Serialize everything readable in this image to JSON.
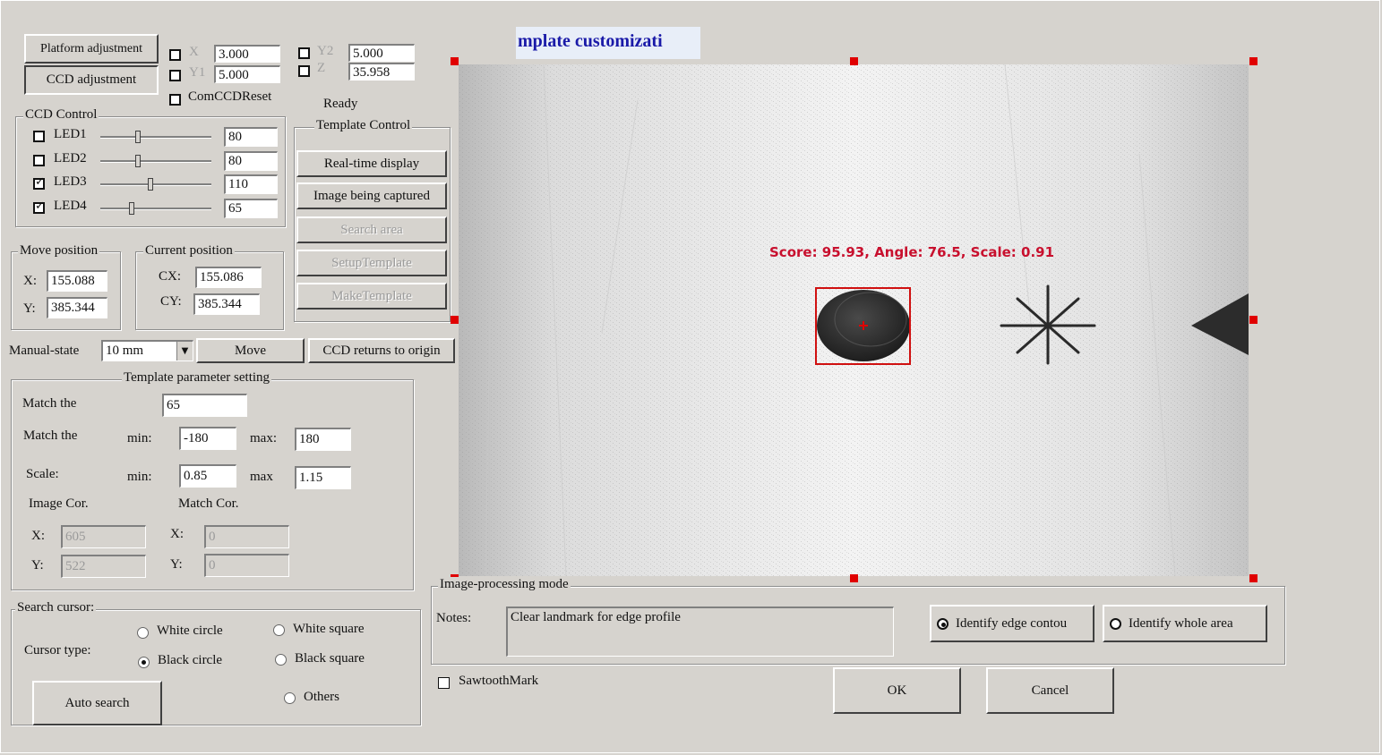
{
  "tabs": {
    "platform_adjustment": "Platform adjustment",
    "ccd_adjustment": "CCD adjustment"
  },
  "coords": {
    "x_label": "X",
    "x_value": "3.000",
    "y1_label": "Y1",
    "y1_value": "5.000",
    "y2_label": "Y2",
    "y2_value": "5.000",
    "z_label": "Z",
    "z_value": "35.958",
    "com_ccd_reset": "ComCCDReset",
    "status": "Ready"
  },
  "ccd_control": {
    "title": "CCD Control",
    "leds": [
      {
        "label": "LED1",
        "checked": false,
        "value": "80",
        "level": 80
      },
      {
        "label": "LED2",
        "checked": false,
        "value": "80",
        "level": 80
      },
      {
        "label": "LED3",
        "checked": true,
        "value": "110",
        "level": 110
      },
      {
        "label": "LED4",
        "checked": true,
        "value": "65",
        "level": 65
      }
    ]
  },
  "template_control": {
    "title": "Template Control",
    "realtime": "Real-time display",
    "captured": "Image being captured",
    "search_area": "Search area",
    "setup_template": "SetupTemplate",
    "make_template": "MakeTemplate"
  },
  "move_position": {
    "title": "Move position",
    "x_label": "X:",
    "x_value": "155.088",
    "y_label": "Y:",
    "y_value": "385.344"
  },
  "current_position": {
    "title": "Current position",
    "cx_label": "CX:",
    "cx_value": "155.086",
    "cy_label": "CY:",
    "cy_value": "385.344"
  },
  "manual": {
    "label": "Manual-state",
    "step": "10 mm",
    "move": "Move",
    "ccd_return": "CCD returns to origin"
  },
  "template_params": {
    "title": "Template parameter setting",
    "match_the_1": "Match the",
    "match_value": "65",
    "match_the_2": "Match the",
    "angle_min_label": "min:",
    "angle_min": "-180",
    "angle_max_label": "max:",
    "angle_max": "180",
    "scale_label": "Scale:",
    "scale_min_label": "min:",
    "scale_min": "0.85",
    "scale_max_label": "max",
    "scale_max": "1.15",
    "image_cor": "Image Cor.",
    "match_cor": "Match Cor.",
    "img_x_label": "X:",
    "img_x": "605",
    "img_y_label": "Y:",
    "img_y": "522",
    "match_x_label": "X:",
    "match_x": "0",
    "match_y_label": "Y:",
    "match_y": "0"
  },
  "search_cursor": {
    "title": "Search cursor:",
    "cursor_type": "Cursor type:",
    "white_circle": "White circle",
    "white_square": "White square",
    "black_circle": "Black circle",
    "black_square": "Black square",
    "others": "Others",
    "auto_search": "Auto search"
  },
  "image_window": {
    "title": "mplate customizati",
    "result": "Score: 95.93, Angle: 76.5, Scale: 0.91"
  },
  "image_processing": {
    "title": "Image-processing mode",
    "notes_label": "Notes:",
    "notes_value": "Clear landmark for edge profile",
    "edge": "Identify edge contou",
    "whole": "Identify whole area"
  },
  "sawtooth": "SawtoothMark",
  "ok": "OK",
  "cancel": "Cancel",
  "colors": {
    "result_text": "#c8102e",
    "title_text": "#1a1aa8",
    "handle": "#e00000"
  }
}
